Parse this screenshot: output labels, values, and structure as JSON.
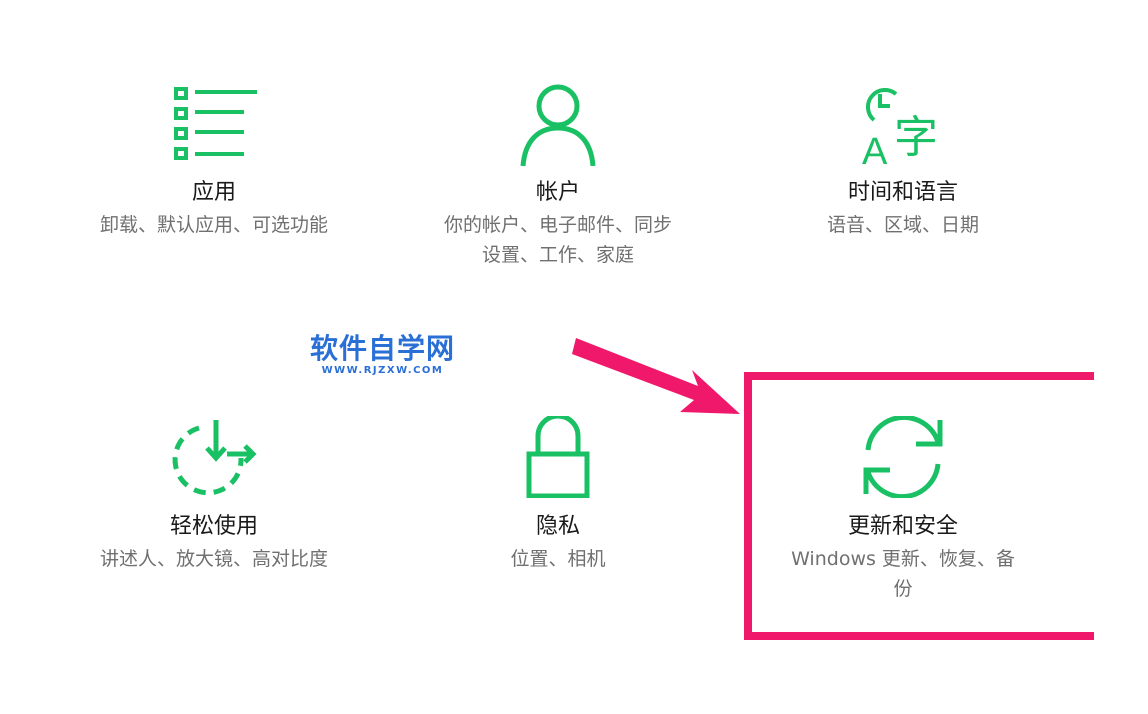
{
  "tiles": {
    "apps": {
      "title": "应用",
      "desc_line1": "卸载、默认应用、可选功能",
      "desc_line2": "",
      "icon": "apps-list-icon"
    },
    "accounts": {
      "title": "帐户",
      "desc_line1": "你的帐户、电子邮件、同步",
      "desc_line2": "设置、工作、家庭",
      "icon": "person-icon"
    },
    "time_language": {
      "title": "时间和语言",
      "desc_line1": "语音、区域、日期",
      "desc_line2": "",
      "icon": "time-language-icon"
    },
    "ease_of_access": {
      "title": "轻松使用",
      "desc_line1": "讲述人、放大镜、高对比度",
      "desc_line2": "",
      "icon": "ease-of-access-icon"
    },
    "privacy": {
      "title": "隐私",
      "desc_line1": "位置、相机",
      "desc_line2": "",
      "icon": "lock-icon"
    },
    "update_security": {
      "title": "更新和安全",
      "desc_line1": "Windows 更新、恢复、备",
      "desc_line2": "份",
      "icon": "sync-icon"
    }
  },
  "watermark": {
    "name": "软件自学网",
    "url": "WWW.RJZXW.COM"
  },
  "colors": {
    "icon_green": "#19c064",
    "highlight_pink": "#f0186a",
    "watermark_blue": "#2a6fd6",
    "title_text": "#1a1a1a",
    "desc_text": "#707070"
  }
}
